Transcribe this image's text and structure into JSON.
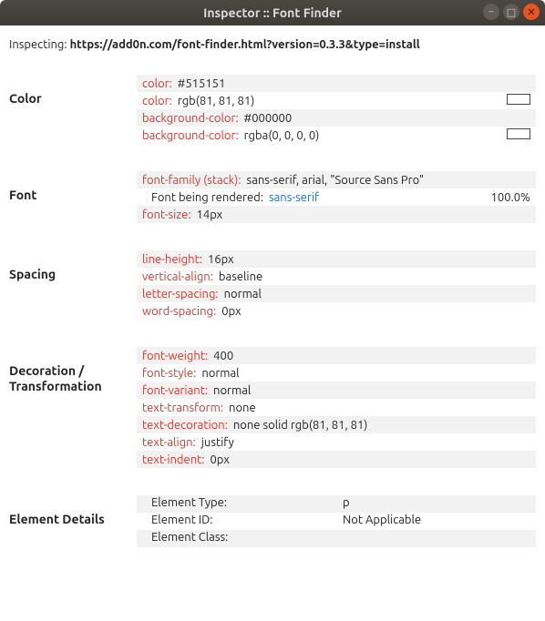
{
  "window": {
    "title": "Inspector :: Font Finder"
  },
  "inspecting": {
    "label": "Inspecting:",
    "url": "https://add0n.com/font-finder.html?version=0.3.3&type=install"
  },
  "sections": {
    "color": {
      "label": "Color",
      "rows": [
        {
          "prop": "color",
          "val": "#515151",
          "swatch": null
        },
        {
          "prop": "color",
          "val": "rgb(81, 81, 81)",
          "swatch": "#515151"
        },
        {
          "prop": "background-color",
          "val": "#000000",
          "swatch": null
        },
        {
          "prop": "background-color",
          "val": "rgba(0, 0, 0, 0)",
          "swatch": "#ffffff"
        }
      ]
    },
    "font": {
      "label": "Font",
      "rows": {
        "family_prop": "font-family (stack)",
        "family_val": "sans-serif, arial, \"Source Sans Pro\"",
        "rendered_label": "Font being rendered:",
        "rendered_val": "sans-serif",
        "rendered_pct": "100.0%",
        "size_prop": "font-size",
        "size_val": "14px"
      }
    },
    "spacing": {
      "label": "Spacing",
      "rows": [
        {
          "prop": "line-height",
          "val": "16px"
        },
        {
          "prop": "vertical-align",
          "val": "baseline"
        },
        {
          "prop": "letter-spacing",
          "val": "normal"
        },
        {
          "prop": "word-spacing",
          "val": "0px"
        }
      ]
    },
    "decoration": {
      "label": "Decoration / Transformation",
      "rows": [
        {
          "prop": "font-weight",
          "val": "400"
        },
        {
          "prop": "font-style",
          "val": "normal"
        },
        {
          "prop": "font-variant",
          "val": "normal"
        },
        {
          "prop": "text-transform",
          "val": "none"
        },
        {
          "prop": "text-decoration",
          "val": "none solid rgb(81, 81, 81)"
        },
        {
          "prop": "text-align",
          "val": "justify"
        },
        {
          "prop": "text-indent",
          "val": "0px"
        }
      ]
    },
    "details": {
      "label": "Element Details",
      "rows": [
        {
          "key": "Element Type:",
          "val": "p"
        },
        {
          "key": "Element ID:",
          "val": "Not Applicable"
        },
        {
          "key": "Element Class:",
          "val": ""
        }
      ]
    }
  }
}
